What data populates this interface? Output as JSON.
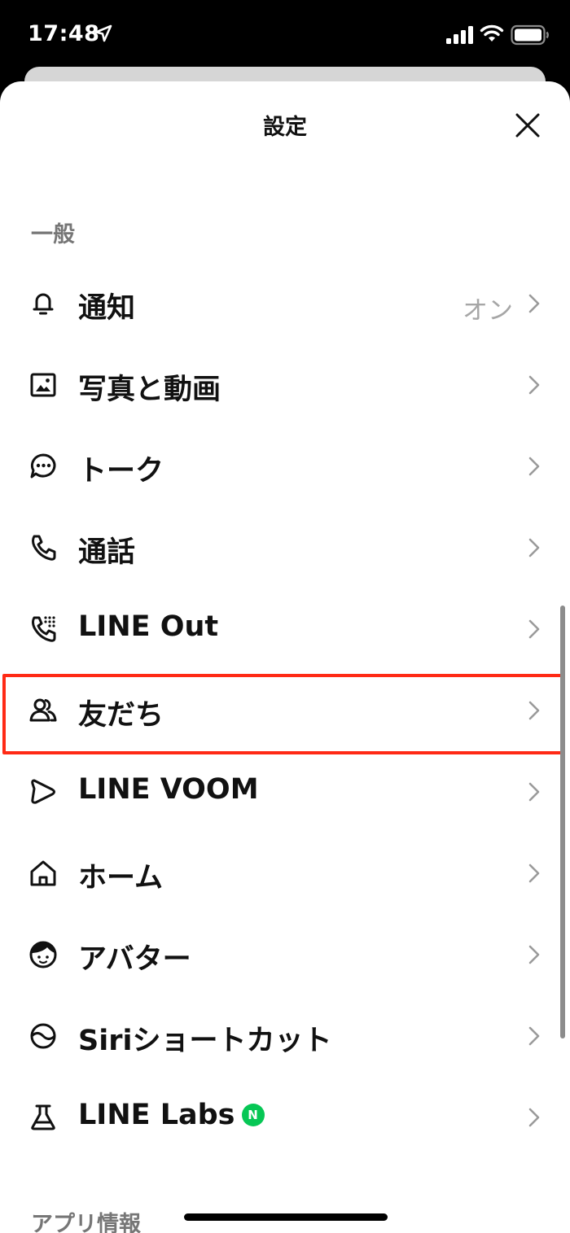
{
  "status_bar": {
    "time": "17:48"
  },
  "header": {
    "title": "設定"
  },
  "sections": {
    "general": "一般",
    "app_info": "アプリ情報"
  },
  "menu": {
    "items": [
      {
        "label": "通知",
        "value": "オン",
        "icon": "bell-icon"
      },
      {
        "label": "写真と動画",
        "icon": "photo-icon"
      },
      {
        "label": "トーク",
        "icon": "chat-bubble-icon"
      },
      {
        "label": "通話",
        "icon": "phone-icon"
      },
      {
        "label": "LINE Out",
        "icon": "phone-keypad-icon"
      },
      {
        "label": "友だち",
        "icon": "friends-icon",
        "highlighted": true
      },
      {
        "label": "LINE VOOM",
        "icon": "voom-icon"
      },
      {
        "label": "ホーム",
        "icon": "home-icon"
      },
      {
        "label": "アバター",
        "icon": "avatar-icon"
      },
      {
        "label": "Siriショートカット",
        "icon": "siri-icon"
      },
      {
        "label": "LINE Labs",
        "icon": "flask-icon",
        "badge": "N"
      }
    ]
  },
  "colors": {
    "highlight": "#ff2a15",
    "badge": "#06c755",
    "muted_text": "#767676"
  }
}
